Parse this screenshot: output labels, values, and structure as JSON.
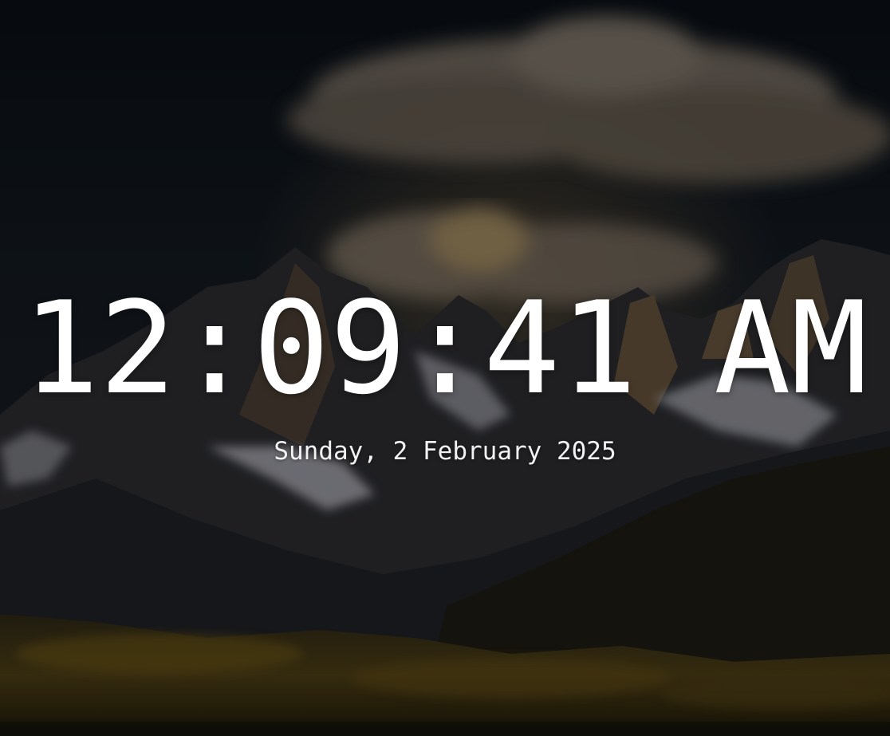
{
  "clock": {
    "time": "12:09:41 AM",
    "date": "Sunday, 2 February 2025"
  },
  "wallpaper": {
    "subject": "mountain-landscape",
    "colors": {
      "sky": "#0c1218",
      "cloud": "#8a7e70",
      "peaks": "#3a3a3e",
      "snow": "#c9c9cf",
      "foreground": "#5a4a1e"
    }
  }
}
